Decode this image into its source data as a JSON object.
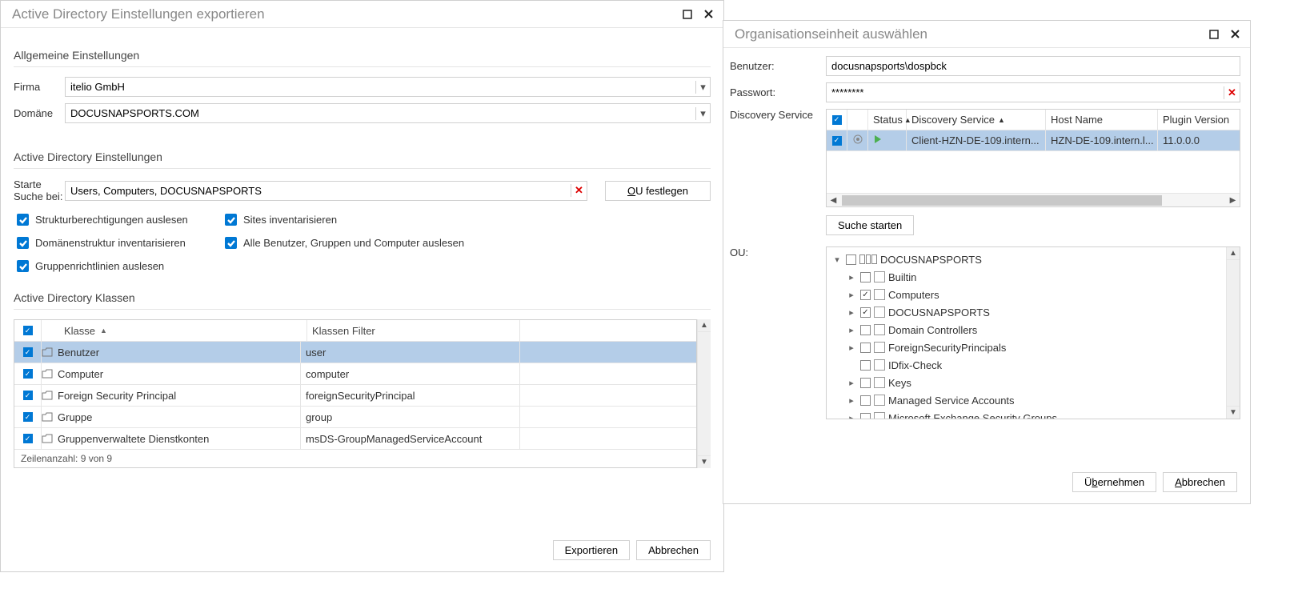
{
  "left": {
    "title": "Active Directory Einstellungen exportieren",
    "section_general": "Allgemeine Einstellungen",
    "firma_label": "Firma",
    "firma_value": "itelio GmbH",
    "domain_label": "Domäne",
    "domain_value": "DOCUSNAPSPORTS.COM",
    "section_ad": "Active Directory Einstellungen",
    "start_label": "Starte Suche bei:",
    "start_value": "Users, Computers, DOCUSNAPSPORTS",
    "ou_button": "OU festlegen",
    "checks": {
      "c1": "Strukturberechtigungen auslesen",
      "c2": "Sites inventarisieren",
      "c3": "Domänenstruktur inventarisieren",
      "c4": "Alle Benutzer, Gruppen und Computer auslesen",
      "c5": "Gruppenrichtlinien auslesen"
    },
    "section_classes": "Active Directory Klassen",
    "table": {
      "col_klasse": "Klasse",
      "col_filter": "Klassen Filter",
      "rows": [
        {
          "klasse": "Benutzer",
          "filter": "user",
          "selected": true
        },
        {
          "klasse": "Computer",
          "filter": "computer"
        },
        {
          "klasse": "Foreign Security Principal",
          "filter": "foreignSecurityPrincipal"
        },
        {
          "klasse": "Gruppe",
          "filter": "group"
        },
        {
          "klasse": "Gruppenverwaltete Dienstkonten",
          "filter": "msDS-GroupManagedServiceAccount"
        }
      ],
      "footer": "Zeilenanzahl: 9 von 9"
    },
    "export_btn": "Exportieren",
    "cancel_btn": "Abbrechen"
  },
  "right": {
    "title": "Organisationseinheit auswählen",
    "user_label": "Benutzer:",
    "user_value": "docusnapsports\\dospbck",
    "pass_label": "Passwort:",
    "pass_value": "********",
    "ds_label": "Discovery Service",
    "ds_head": {
      "status": "Status",
      "ds": "Discovery Service",
      "host": "Host Name",
      "plugin": "Plugin Version"
    },
    "ds_row": {
      "ds": "Client-HZN-DE-109.intern...",
      "host": "HZN-DE-109.intern.l...",
      "plugin": "11.0.0.0"
    },
    "search_btn": "Suche starten",
    "ou_label": "OU:",
    "tree": [
      {
        "level": 0,
        "exp": "▾",
        "checked": false,
        "icon": "domain",
        "label": "DOCUSNAPSPORTS"
      },
      {
        "level": 1,
        "exp": "▸",
        "checked": false,
        "icon": "ou",
        "label": "Builtin"
      },
      {
        "level": 1,
        "exp": "▸",
        "checked": true,
        "icon": "ou",
        "label": "Computers"
      },
      {
        "level": 1,
        "exp": "▸",
        "checked": true,
        "icon": "ou",
        "label": "DOCUSNAPSPORTS"
      },
      {
        "level": 1,
        "exp": "▸",
        "checked": false,
        "icon": "ou",
        "label": "Domain Controllers"
      },
      {
        "level": 1,
        "exp": "▸",
        "checked": false,
        "icon": "ou",
        "label": "ForeignSecurityPrincipals"
      },
      {
        "level": 1,
        "exp": "",
        "checked": false,
        "icon": "ou",
        "label": "IDfix-Check"
      },
      {
        "level": 1,
        "exp": "▸",
        "checked": false,
        "icon": "ou",
        "label": "Keys"
      },
      {
        "level": 1,
        "exp": "▸",
        "checked": false,
        "icon": "ou",
        "label": "Managed Service Accounts"
      },
      {
        "level": 1,
        "exp": "▸",
        "checked": false,
        "icon": "ou",
        "label": "Microsoft Exchange Security Groups"
      }
    ],
    "apply_btn": "Übernehmen",
    "cancel_btn": "Abbrechen"
  }
}
